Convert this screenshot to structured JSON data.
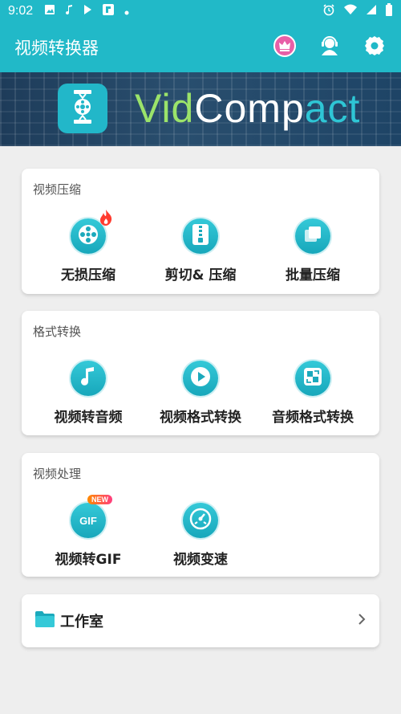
{
  "status_bar": {
    "time": "9:02",
    "left_icons": [
      "image-icon",
      "music-note-icon",
      "play-icon",
      "flipboard-icon",
      "dot-icon"
    ],
    "right_icons": [
      "alarm-icon",
      "wifi-icon",
      "signal-icon",
      "battery-icon"
    ]
  },
  "app_bar": {
    "title": "视频转换器",
    "actions": [
      "vip-crown-icon",
      "support-agent-icon",
      "settings-icon"
    ]
  },
  "banner": {
    "brand_part1": "Vid",
    "brand_part2": "Comp",
    "brand_part3": "act"
  },
  "sections": [
    {
      "title": "视频压缩",
      "items": [
        {
          "label": "无损压缩",
          "icon": "film-reel-icon",
          "badge": "fire"
        },
        {
          "label": "剪切& 压缩",
          "icon": "zip-file-icon"
        },
        {
          "label": "批量压缩",
          "icon": "stack-icon"
        }
      ]
    },
    {
      "title": "格式转换",
      "items": [
        {
          "label": "视频转音频",
          "icon": "music-note-icon"
        },
        {
          "label": "视频格式转换",
          "icon": "play-icon"
        },
        {
          "label": "音频格式转换",
          "icon": "convert-icon"
        }
      ]
    },
    {
      "title": "视频处理",
      "items": [
        {
          "label": "视频转GIF",
          "icon": "gif-icon",
          "badge": "NEW"
        },
        {
          "label": "视频变速",
          "icon": "speedometer-icon"
        }
      ]
    }
  ],
  "studio": {
    "label": "工作室",
    "icon": "folder-icon"
  },
  "colors": {
    "primary": "#21b9c8",
    "background": "#eeeeee",
    "card": "#ffffff",
    "badge_crown_bg": "#e85fa7"
  }
}
